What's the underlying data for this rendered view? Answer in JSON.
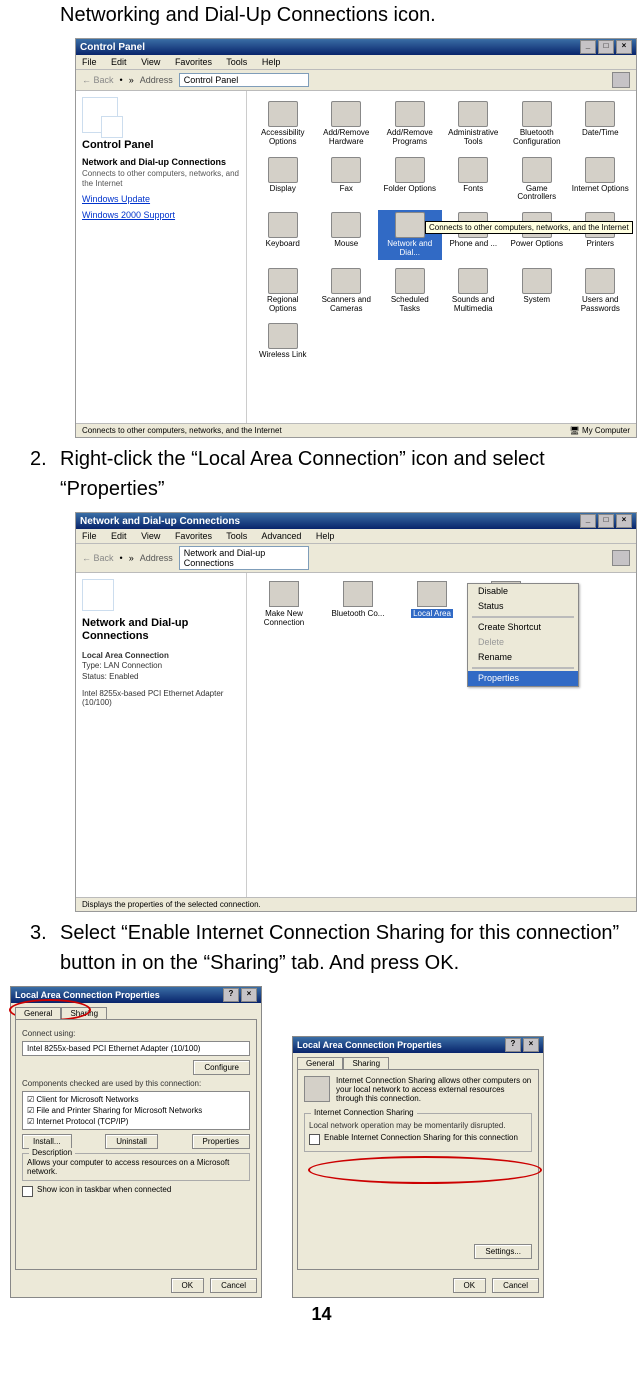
{
  "intro_line": "Networking and Dial-Up Connections icon.",
  "step2": {
    "num": "2.",
    "text": "Right-click the “Local Area Connection” icon and select “Properties”"
  },
  "step3": {
    "num": "3.",
    "text": "Select “Enable Internet Connection Sharing for this connection” button in on the “Sharing” tab. And press OK."
  },
  "page_number": "14",
  "cp": {
    "title": "Control Panel",
    "menus": [
      "File",
      "Edit",
      "View",
      "Favorites",
      "Tools",
      "Help"
    ],
    "toolbar": {
      "back": "Back",
      "address_label": "Address",
      "address_value": "Control Panel"
    },
    "side": {
      "heading": "Control Panel",
      "sub": "Network and Dial-up Connections",
      "desc": "Connects to other computers, networks, and the Internet",
      "link1": "Windows Update",
      "link2": "Windows 2000 Support"
    },
    "icons": [
      "Accessibility Options",
      "Add/Remove Hardware",
      "Add/Remove Programs",
      "Administrative Tools",
      "Bluetooth Configuration",
      "Date/Time",
      "Display",
      "Fax",
      "Folder Options",
      "Fonts",
      "Game Controllers",
      "Internet Options",
      "Keyboard",
      "Mouse",
      "Network and Dial...",
      "Phone and ...",
      "Power Options",
      "Printers",
      "Regional Options",
      "Scanners and Cameras",
      "Scheduled Tasks",
      "Sounds and Multimedia",
      "System",
      "Users and Passwords",
      "Wireless Link"
    ],
    "selected_index": 14,
    "tooltip": "Connects to other computers, networks, and the Internet",
    "status_left": "Connects to other computers, networks, and the Internet",
    "status_right": "My Computer"
  },
  "nc": {
    "title": "Network and Dial-up Connections",
    "menus": [
      "File",
      "Edit",
      "View",
      "Favorites",
      "Tools",
      "Advanced",
      "Help"
    ],
    "toolbar": {
      "back": "Back",
      "address_label": "Address",
      "address_value": "Network and Dial-up Connections"
    },
    "side": {
      "heading": "Network and Dial-up Connections",
      "k1": "Local Area Connection",
      "v1": "Type: LAN Connection",
      "v2": "Status: Enabled",
      "v3": "Intel 8255x-based PCI Ethernet Adapter (10/100)"
    },
    "icons": [
      "Make New Connection",
      "Bluetooth Co...",
      "Local Area",
      "Local Area"
    ],
    "selected_index": 2,
    "ctx": {
      "items": [
        "Disable",
        "Status",
        "",
        "Create Shortcut",
        "Delete",
        "Rename",
        "",
        "Properties"
      ],
      "selected": "Properties"
    },
    "status": "Displays the properties of the selected connection."
  },
  "dlg1": {
    "title": "Local Area Connection Properties",
    "tabs": [
      "General",
      "Sharing"
    ],
    "connect_using": "Connect using:",
    "adapter": "Intel 8255x-based PCI Ethernet Adapter (10/100)",
    "configure": "Configure",
    "components_label": "Components checked are used by this connection:",
    "components": [
      "Client for Microsoft Networks",
      "File and Printer Sharing for Microsoft Networks",
      "Internet Protocol (TCP/IP)"
    ],
    "btn_install": "Install...",
    "btn_uninstall": "Uninstall",
    "btn_props": "Properties",
    "desc_label": "Description",
    "desc_text": "Allows your computer to access resources on a Microsoft network.",
    "show_icon": "Show icon in taskbar when connected",
    "ok": "OK",
    "cancel": "Cancel"
  },
  "dlg2": {
    "title": "Local Area Connection Properties",
    "tabs": [
      "General",
      "Sharing"
    ],
    "intro": "Internet Connection Sharing allows other computers on your local network to access external resources through this connection.",
    "group": "Internet Connection Sharing",
    "warn": "Local network operation may be momentarily disrupted.",
    "enable": "Enable Internet Connection Sharing for this connection",
    "settings": "Settings...",
    "ok": "OK",
    "cancel": "Cancel"
  }
}
